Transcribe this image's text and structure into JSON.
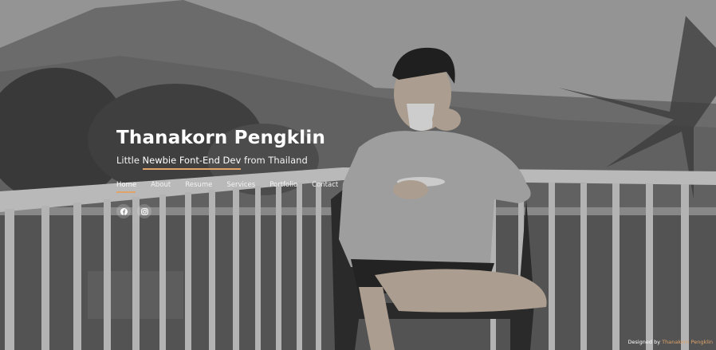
{
  "profile": {
    "name": "Thanakorn Pengklin",
    "tagline_prefix": "Little",
    "tagline_highlight": "Newbie Font-End Dev",
    "tagline_suffix": "from Thailand"
  },
  "nav": {
    "items": [
      {
        "label": "Home"
      },
      {
        "label": "About"
      },
      {
        "label": "Resume"
      },
      {
        "label": "Services"
      },
      {
        "label": "Portfolio"
      },
      {
        "label": "Contact"
      }
    ],
    "active_index": 0
  },
  "social": {
    "icons": [
      "facebook-icon",
      "instagram-icon"
    ]
  },
  "footer": {
    "credit_prefix": "Designed by",
    "credit_author": "Thanakorn Pengklin"
  },
  "colors": {
    "accent": "#e0a36a",
    "text": "#ffffff"
  }
}
